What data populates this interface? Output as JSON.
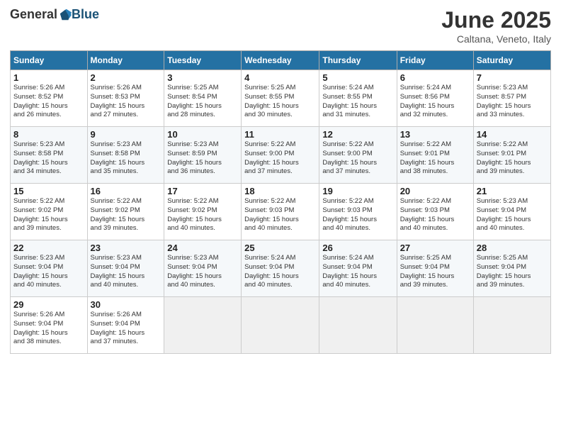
{
  "logo": {
    "general": "General",
    "blue": "Blue"
  },
  "title": "June 2025",
  "location": "Caltana, Veneto, Italy",
  "weekdays": [
    "Sunday",
    "Monday",
    "Tuesday",
    "Wednesday",
    "Thursday",
    "Friday",
    "Saturday"
  ],
  "weeks": [
    [
      {
        "day": "1",
        "sunrise": "5:26 AM",
        "sunset": "8:52 PM",
        "daylight": "15 hours and 26 minutes."
      },
      {
        "day": "2",
        "sunrise": "5:26 AM",
        "sunset": "8:53 PM",
        "daylight": "15 hours and 27 minutes."
      },
      {
        "day": "3",
        "sunrise": "5:25 AM",
        "sunset": "8:54 PM",
        "daylight": "15 hours and 28 minutes."
      },
      {
        "day": "4",
        "sunrise": "5:25 AM",
        "sunset": "8:55 PM",
        "daylight": "15 hours and 30 minutes."
      },
      {
        "day": "5",
        "sunrise": "5:24 AM",
        "sunset": "8:55 PM",
        "daylight": "15 hours and 31 minutes."
      },
      {
        "day": "6",
        "sunrise": "5:24 AM",
        "sunset": "8:56 PM",
        "daylight": "15 hours and 32 minutes."
      },
      {
        "day": "7",
        "sunrise": "5:23 AM",
        "sunset": "8:57 PM",
        "daylight": "15 hours and 33 minutes."
      }
    ],
    [
      {
        "day": "8",
        "sunrise": "5:23 AM",
        "sunset": "8:58 PM",
        "daylight": "15 hours and 34 minutes."
      },
      {
        "day": "9",
        "sunrise": "5:23 AM",
        "sunset": "8:58 PM",
        "daylight": "15 hours and 35 minutes."
      },
      {
        "day": "10",
        "sunrise": "5:23 AM",
        "sunset": "8:59 PM",
        "daylight": "15 hours and 36 minutes."
      },
      {
        "day": "11",
        "sunrise": "5:22 AM",
        "sunset": "9:00 PM",
        "daylight": "15 hours and 37 minutes."
      },
      {
        "day": "12",
        "sunrise": "5:22 AM",
        "sunset": "9:00 PM",
        "daylight": "15 hours and 37 minutes."
      },
      {
        "day": "13",
        "sunrise": "5:22 AM",
        "sunset": "9:01 PM",
        "daylight": "15 hours and 38 minutes."
      },
      {
        "day": "14",
        "sunrise": "5:22 AM",
        "sunset": "9:01 PM",
        "daylight": "15 hours and 39 minutes."
      }
    ],
    [
      {
        "day": "15",
        "sunrise": "5:22 AM",
        "sunset": "9:02 PM",
        "daylight": "15 hours and 39 minutes."
      },
      {
        "day": "16",
        "sunrise": "5:22 AM",
        "sunset": "9:02 PM",
        "daylight": "15 hours and 39 minutes."
      },
      {
        "day": "17",
        "sunrise": "5:22 AM",
        "sunset": "9:02 PM",
        "daylight": "15 hours and 40 minutes."
      },
      {
        "day": "18",
        "sunrise": "5:22 AM",
        "sunset": "9:03 PM",
        "daylight": "15 hours and 40 minutes."
      },
      {
        "day": "19",
        "sunrise": "5:22 AM",
        "sunset": "9:03 PM",
        "daylight": "15 hours and 40 minutes."
      },
      {
        "day": "20",
        "sunrise": "5:22 AM",
        "sunset": "9:03 PM",
        "daylight": "15 hours and 40 minutes."
      },
      {
        "day": "21",
        "sunrise": "5:23 AM",
        "sunset": "9:04 PM",
        "daylight": "15 hours and 40 minutes."
      }
    ],
    [
      {
        "day": "22",
        "sunrise": "5:23 AM",
        "sunset": "9:04 PM",
        "daylight": "15 hours and 40 minutes."
      },
      {
        "day": "23",
        "sunrise": "5:23 AM",
        "sunset": "9:04 PM",
        "daylight": "15 hours and 40 minutes."
      },
      {
        "day": "24",
        "sunrise": "5:23 AM",
        "sunset": "9:04 PM",
        "daylight": "15 hours and 40 minutes."
      },
      {
        "day": "25",
        "sunrise": "5:24 AM",
        "sunset": "9:04 PM",
        "daylight": "15 hours and 40 minutes."
      },
      {
        "day": "26",
        "sunrise": "5:24 AM",
        "sunset": "9:04 PM",
        "daylight": "15 hours and 40 minutes."
      },
      {
        "day": "27",
        "sunrise": "5:25 AM",
        "sunset": "9:04 PM",
        "daylight": "15 hours and 39 minutes."
      },
      {
        "day": "28",
        "sunrise": "5:25 AM",
        "sunset": "9:04 PM",
        "daylight": "15 hours and 39 minutes."
      }
    ],
    [
      {
        "day": "29",
        "sunrise": "5:26 AM",
        "sunset": "9:04 PM",
        "daylight": "15 hours and 38 minutes."
      },
      {
        "day": "30",
        "sunrise": "5:26 AM",
        "sunset": "9:04 PM",
        "daylight": "15 hours and 37 minutes."
      },
      null,
      null,
      null,
      null,
      null
    ]
  ],
  "labels": {
    "sunrise": "Sunrise:",
    "sunset": "Sunset:",
    "daylight": "Daylight:"
  }
}
